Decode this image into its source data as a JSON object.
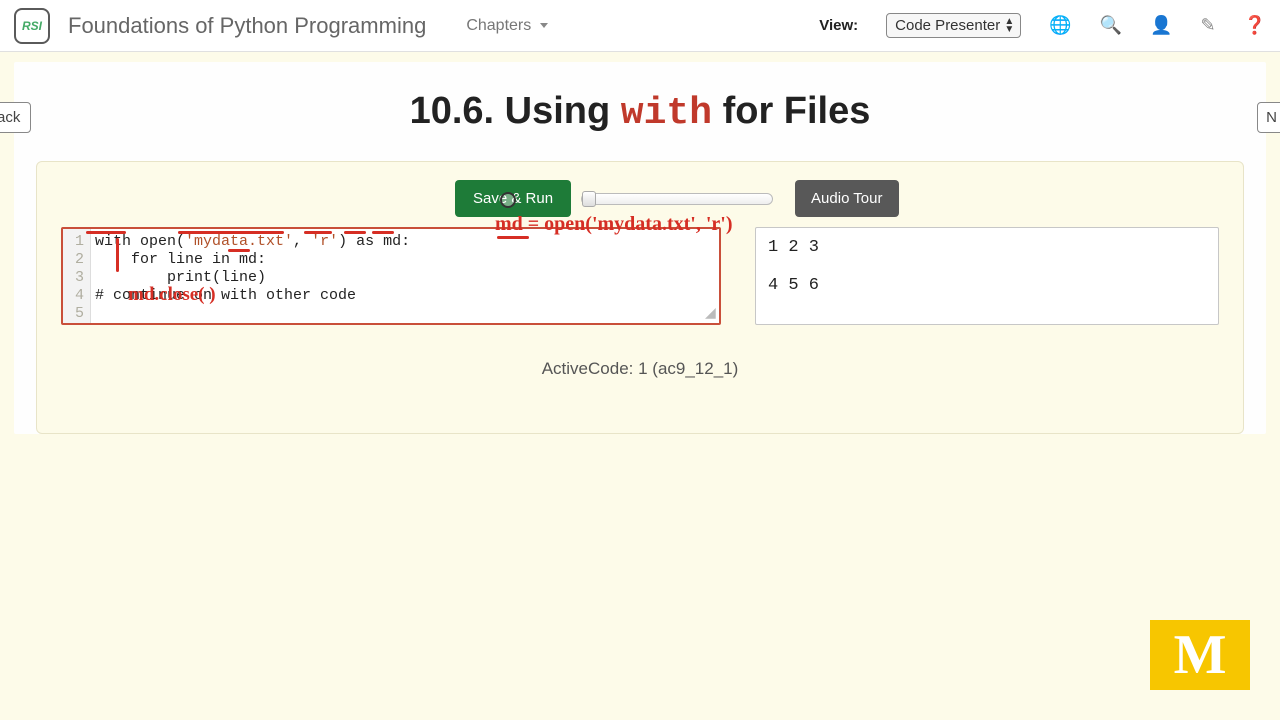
{
  "navbar": {
    "logo_text": "RSI",
    "book_title": "Foundations of Python Programming",
    "chapters_label": "Chapters",
    "view_label": "View:",
    "view_value": "Code Presenter"
  },
  "nav_buttons": {
    "back": "ack",
    "next": "N"
  },
  "page": {
    "title_prefix": "10.6. Using ",
    "title_keyword": "with",
    "title_suffix": " for Files"
  },
  "toolbar": {
    "run_label": "Save & Run",
    "audio_label": "Audio Tour"
  },
  "editor": {
    "line_numbers": [
      "1",
      "2",
      "3",
      "4",
      "5"
    ],
    "lines": [
      {
        "prefix": "with open(",
        "str": "'mydata.txt'",
        "mid": ", ",
        "str2": "'r'",
        "suffix": ") as md:"
      },
      {
        "plain": "    for line in md:"
      },
      {
        "plain": "        print(line)"
      },
      {
        "plain": "# continue on with other code"
      },
      {
        "plain": ""
      }
    ]
  },
  "output": {
    "text": "1 2 3\n\n4 5 6"
  },
  "annotations": {
    "equiv_open": "md = open('mydata.txt', 'r')",
    "equiv_close": "md.close( )"
  },
  "caption": "ActiveCode: 1 (ac9_12_1)",
  "logo_letter": "M"
}
